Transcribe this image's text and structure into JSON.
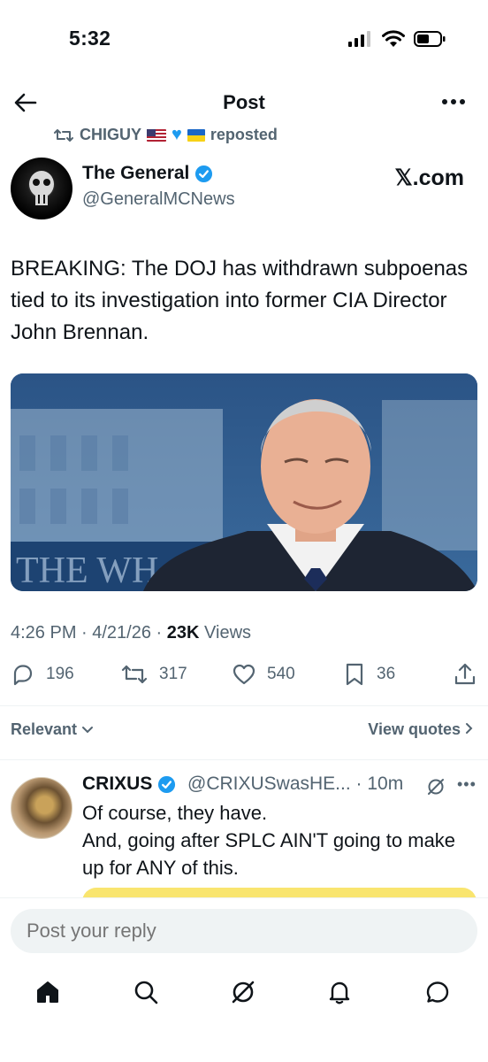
{
  "status": {
    "time": "5:32"
  },
  "header": {
    "title": "Post"
  },
  "repost": {
    "user": "CHIGUY",
    "suffix": "reposted"
  },
  "post": {
    "author_name": "The General",
    "author_handle": "@GeneralMCNews",
    "source": "𝕏.com",
    "text": "BREAKING: The DOJ has withdrawn subpoenas tied to its investigation into former CIA Director John Brennan.",
    "image_sign_text": "THE WH",
    "time": "4:26 PM · 4/21/26 · ",
    "views_count": "23K",
    "views_label": " Views",
    "replies": "196",
    "reposts": "317",
    "likes": "540",
    "bookmarks": "36"
  },
  "filters": {
    "relevant": "Relevant",
    "view_quotes": "View quotes"
  },
  "reply": {
    "name": "CRIXUS",
    "handle": "@CRIXUSwasHE... · 10m",
    "line1": "Of course, they have.",
    "line2": "And, going after SPLC AIN'T going to make up for ANY of this."
  },
  "compose": {
    "placeholder": "Post your reply"
  },
  "icons": {
    "back": "arrow-left-icon",
    "more": "more-horizontal-icon",
    "repost": "repost-icon",
    "verified": "verified-badge-icon",
    "reply": "comment-icon",
    "like": "heart-icon",
    "bookmark": "bookmark-icon",
    "share": "share-icon",
    "grok": "grok-icon",
    "home": "home-icon",
    "search": "search-icon",
    "notifications": "bell-icon",
    "messages": "message-icon"
  },
  "colors": {
    "accent": "#1d9bf0",
    "secondary_text": "#536471",
    "primary_text": "#0f1419"
  }
}
